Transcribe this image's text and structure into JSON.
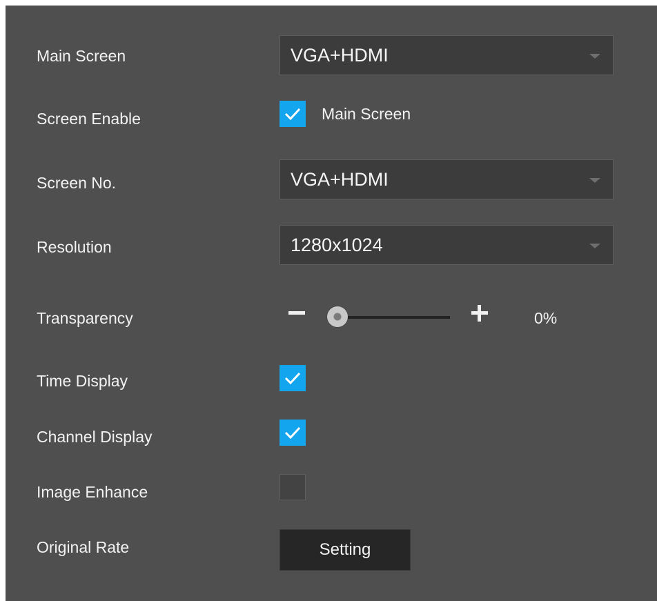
{
  "rows": {
    "main_screen": {
      "label": "Main Screen",
      "value": "VGA+HDMI"
    },
    "screen_enable": {
      "label": "Screen Enable",
      "checkbox_label": "Main Screen",
      "checked": true
    },
    "screen_no": {
      "label": "Screen No.",
      "value": "VGA+HDMI"
    },
    "resolution": {
      "label": "Resolution",
      "value": "1280x1024"
    },
    "transparency": {
      "label": "Transparency",
      "value_text": "0%",
      "level": 0
    },
    "time_display": {
      "label": "Time Display",
      "checked": true
    },
    "channel_display": {
      "label": "Channel Display",
      "checked": true
    },
    "image_enhance": {
      "label": "Image Enhance",
      "checked": false
    },
    "original_rate": {
      "label": "Original Rate",
      "button_label": "Setting"
    }
  },
  "colors": {
    "panel_background": "#4f4f4f",
    "checkbox_checked": "#14a5ef",
    "dropdown_background": "#3c3c3c"
  },
  "icons": {
    "check": "check-icon",
    "dropdown": "caret-down-icon",
    "decrease": "minus-icon",
    "increase": "plus-icon"
  }
}
